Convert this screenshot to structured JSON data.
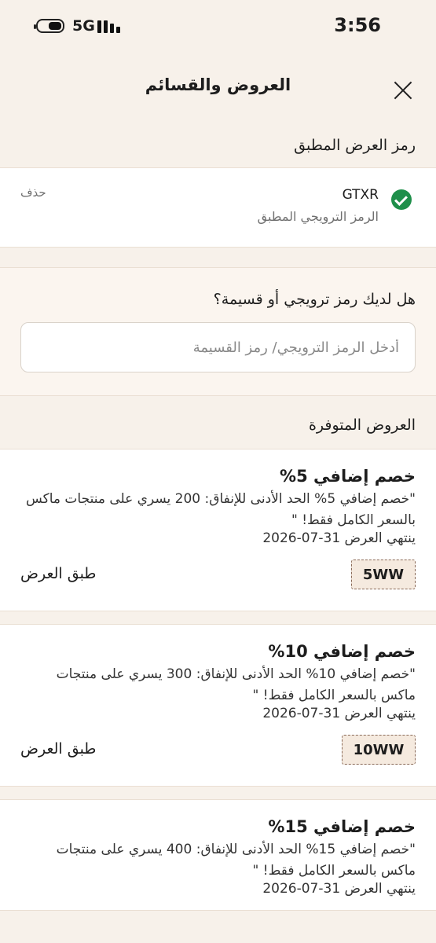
{
  "status_bar": {
    "network": "5G",
    "time": "3:56"
  },
  "header": {
    "title": "العروض والقسائم"
  },
  "applied": {
    "section_title": "رمز العرض المطبق",
    "code": "GTXR",
    "subtitle": "الرمز الترويجي المطبق",
    "remove_label": "حذف"
  },
  "promo": {
    "question": "هل لديك رمز ترويجي أو قسيمة؟",
    "placeholder": "أدخل الرمز الترويجي/ رمز القسيمة"
  },
  "offers": {
    "section_title": "العروض المتوفرة",
    "apply_label": "طبق العرض",
    "items": [
      {
        "title": "خصم إضافي 5%",
        "description": "\"خصم إضافي 5%   الحد الأدنى للإنفاق: 200 يسري على منتجات ماكس بالسعر الكامل فقط! \"",
        "expiry": "ينتهي العرض  31-07-2026",
        "code": "5WW"
      },
      {
        "title": "خصم إضافي 10%",
        "description": "\"خصم إضافي 10%   الحد الأدنى للإنفاق: 300 يسري على منتجات ماكس بالسعر الكامل فقط! \"",
        "expiry": "ينتهي العرض  31-07-2026",
        "code": "10WW"
      },
      {
        "title": "خصم إضافي 15%",
        "description": "\"خصم إضافي 15%   الحد الأدنى للإنفاق: 400 يسري على منتجات ماكس بالسعر الكامل فقط! \"",
        "expiry": "ينتهي العرض  31-07-2026",
        "code": ""
      }
    ]
  }
}
